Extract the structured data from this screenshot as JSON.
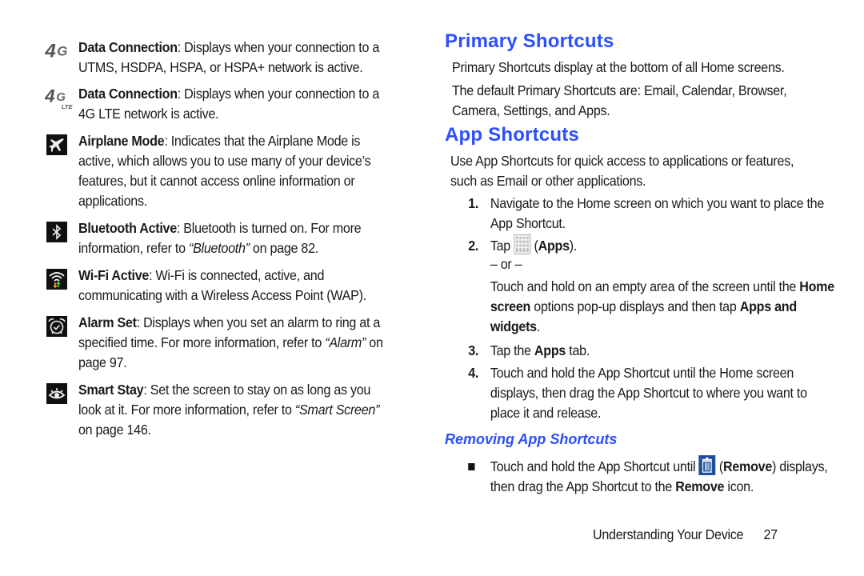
{
  "left_column": {
    "items": [
      {
        "icon": "4g-icon",
        "term": "Data Connection",
        "text": ": Displays when your connection to a UTMS, HSDPA, HSPA, or HSPA+ network is active."
      },
      {
        "icon": "4g-lte-icon",
        "term": "Data Connection",
        "text": ": Displays when your connection to a 4G LTE network is active."
      },
      {
        "icon": "airplane-icon",
        "term": "Airplane Mode",
        "text": ": Indicates that the Airplane Mode is active, which allows you to use many of your device’s features, but it cannot access online information or applications."
      },
      {
        "icon": "bluetooth-icon",
        "term": "Bluetooth Active",
        "text": ": Bluetooth is turned on. For more information, refer to ",
        "ref": "“Bluetooth”",
        "after": " on page 82."
      },
      {
        "icon": "wifi-icon",
        "term": "Wi-Fi Active",
        "text": ": Wi-Fi is connected, active, and communicating with a Wireless Access Point (WAP)."
      },
      {
        "icon": "alarm-icon",
        "term": "Alarm Set",
        "text": ": Displays when you set an alarm to ring at a specified time. For more information, refer to ",
        "ref": "“Alarm”",
        "after": " on page 97."
      },
      {
        "icon": "smart-stay-icon",
        "term": "Smart Stay",
        "text": ": Set the screen to stay on as long as you look at it. For more information, refer to ",
        "ref": "“Smart Screen”",
        "after": " on page 146."
      }
    ]
  },
  "right_column": {
    "primary": {
      "heading": "Primary Shortcuts",
      "p1": "Primary Shortcuts display at the bottom of all Home screens.",
      "p2": "The default Primary Shortcuts are: Email, Calendar, Browser, Camera, Settings, and Apps."
    },
    "app": {
      "heading": "App Shortcuts",
      "intro": "Use App Shortcuts for quick access to applications or features, such as Email or other applications.",
      "step1_num": "1.",
      "step1": "Navigate to the Home screen on which you want to place the App Shortcut.",
      "step2_num": "2.",
      "step2_pre": "Tap ",
      "step2_bold": "Apps",
      "step2_post": ").",
      "step2_open": " (",
      "or": "– or –",
      "alt_pre": "Touch and hold on an empty area of the screen until the ",
      "alt_bold1": "Home screen",
      "alt_mid": " options pop-up displays and then tap ",
      "alt_bold2": "Apps and widgets",
      "alt_end": ".",
      "step3_num": "3.",
      "step3_pre": "Tap the ",
      "step3_bold": "Apps",
      "step3_post": " tab.",
      "step4_num": "4.",
      "step4": "Touch and hold the App Shortcut until the Home screen displays, then drag the App Shortcut to where you want to place it and release."
    },
    "removing": {
      "heading": "Removing App Shortcuts",
      "pre": "Touch and hold the App Shortcut until ",
      "open": " (",
      "bold1": "Remove",
      "mid": ") displays, then drag the App Shortcut to the ",
      "bold2": "Remove",
      "end": " icon."
    }
  },
  "footer": {
    "section": "Understanding Your Device",
    "page": "27"
  },
  "colors": {
    "heading": "#2b4eff",
    "text": "#1a1a1a",
    "remove_icon": "#1e4f9c"
  }
}
